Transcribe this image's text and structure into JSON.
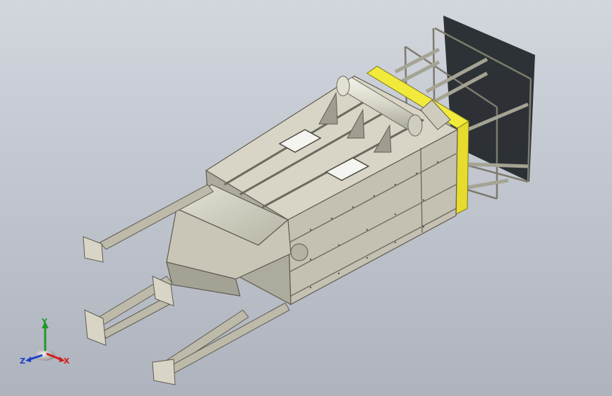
{
  "viewport": {
    "background_top": "#d2d6dd",
    "background_bottom": "#aeb3bd"
  },
  "model": {
    "frame_color": "#a8a594",
    "panel_light": "#dad7c8",
    "panel_mid": "#bebbac",
    "panel_dark": "#8f8d80",
    "accent_yellow": "#f2ea3a",
    "shadow_color": "#202428"
  },
  "triad": {
    "x_label": "X",
    "y_label": "Y",
    "z_label": "Z",
    "x_color": "#d02020",
    "y_color": "#1f9a2a",
    "z_color": "#2040c8"
  }
}
